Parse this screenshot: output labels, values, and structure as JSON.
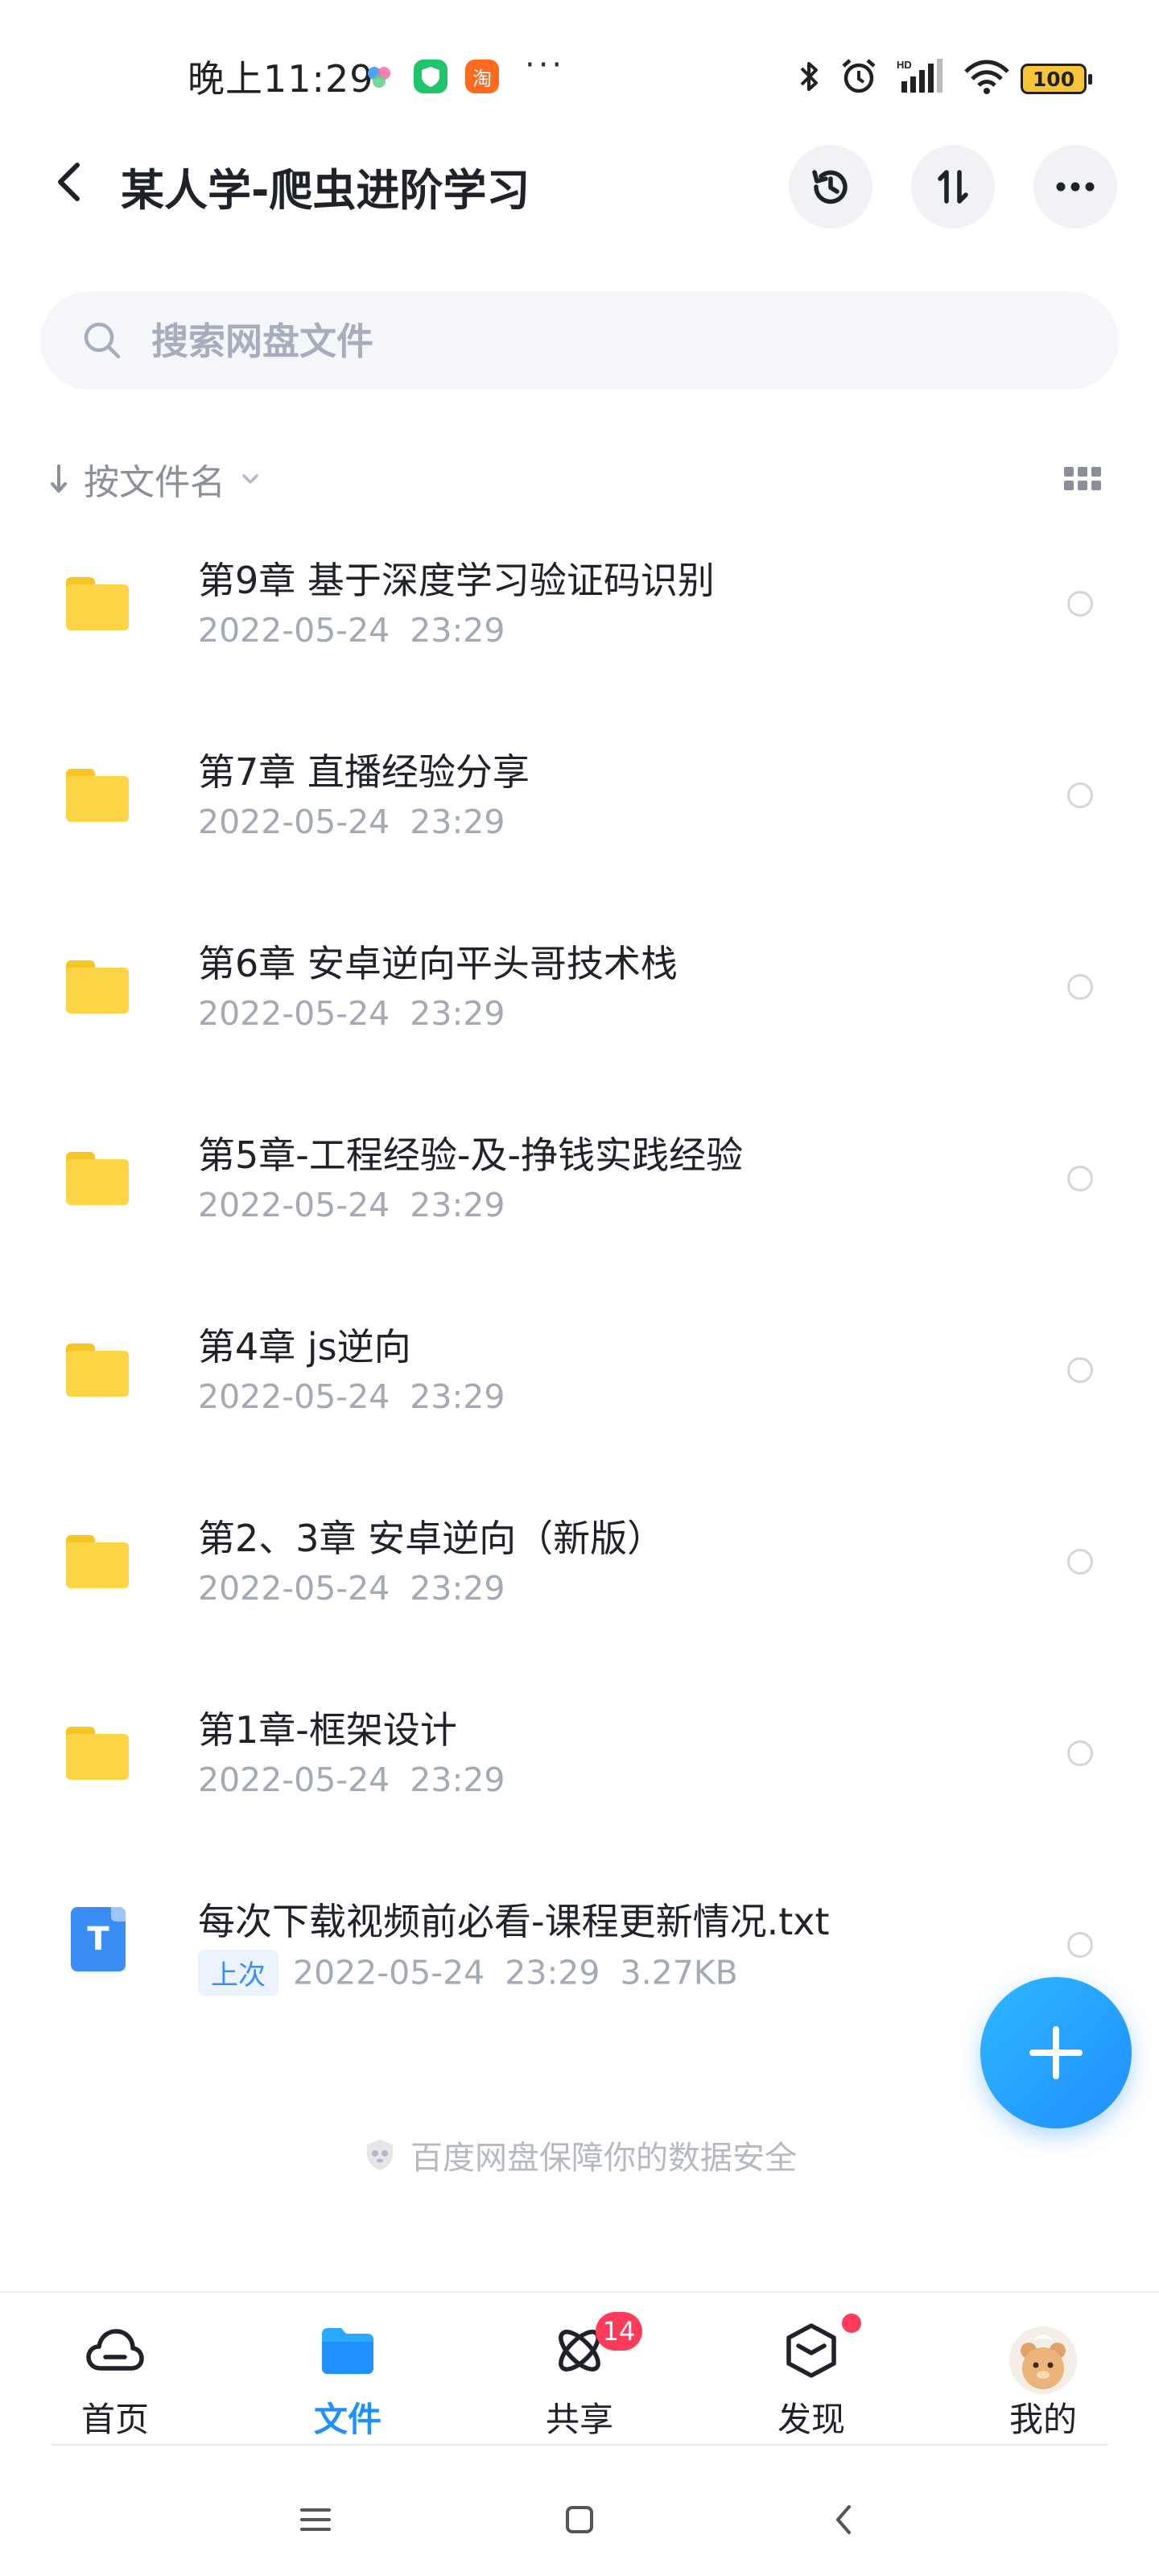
{
  "status_bar": {
    "time": "晚上11:29",
    "app_icons": [
      "cloud-app-icon",
      "shield-app-icon",
      "taobao-app-icon"
    ],
    "taobao_label": "淘",
    "more_dots": "···",
    "battery": "100"
  },
  "header": {
    "title": "某人学-爬虫进阶学习"
  },
  "search": {
    "placeholder": "搜索网盘文件"
  },
  "sort": {
    "label": "按文件名"
  },
  "files": [
    {
      "type": "folder",
      "name": "第9章  基于深度学习验证码识别",
      "date": "2022-05-24  23:29"
    },
    {
      "type": "folder",
      "name": "第7章  直播经验分享",
      "date": "2022-05-24  23:29"
    },
    {
      "type": "folder",
      "name": "第6章  安卓逆向平头哥技术栈",
      "date": "2022-05-24  23:29"
    },
    {
      "type": "folder",
      "name": "第5章-工程经验-及-挣钱实践经验",
      "date": "2022-05-24  23:29"
    },
    {
      "type": "folder",
      "name": "第4章  js逆向",
      "date": "2022-05-24  23:29"
    },
    {
      "type": "folder",
      "name": "第2、3章  安卓逆向（新版）",
      "date": "2022-05-24  23:29"
    },
    {
      "type": "folder",
      "name": "第1章-框架设计",
      "date": "2022-05-24  23:29"
    },
    {
      "type": "txt",
      "icon_letter": "T",
      "name": "每次下载视频前必看-课程更新情况.txt",
      "tag": "上次",
      "date": "2022-05-24  23:29  3.27KB"
    }
  ],
  "footer": {
    "safety_note": "百度网盘保障你的数据安全"
  },
  "tab_bar": {
    "items": [
      {
        "label": "首页",
        "icon": "cloud-home-icon"
      },
      {
        "label": "文件",
        "icon": "folder-icon"
      },
      {
        "label": "共享",
        "icon": "share-atom-icon",
        "badge": "14"
      },
      {
        "label": "发现",
        "icon": "discover-box-icon"
      },
      {
        "label": "我的",
        "icon": "avatar"
      }
    ],
    "active_index": 1
  },
  "colors": {
    "accent": "#1f90ff",
    "folder": "#fdd446",
    "badge": "#ff3b5c"
  }
}
